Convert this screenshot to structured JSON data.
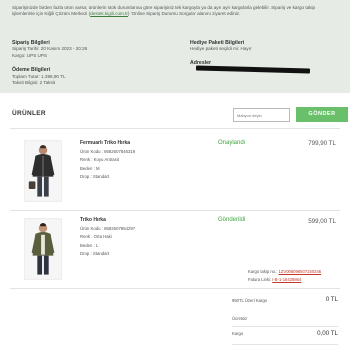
{
  "notice": {
    "text": "Siparişinizde birden fazla ürün varsa; ürünlerin stok durumlarına göre siparişiniz tek kargoyla ya da ayrı ayrı kargolarla gelebilir. Sipariş ve kargo takip işlemlerinle için Kiğili Çözüm Merkezi (",
    "link": "destek.kigili.com.tr",
    "text_after": ") 'Online Sipariş Durumu Sorgula' alanını ziyaret ediniz."
  },
  "order": {
    "heading": "Sipariş Bilgileri",
    "date": "Sipariş Tarihi: 20 Kasım 2023 - 20:26",
    "cargo": "Kargo: UPS UPS"
  },
  "payment": {
    "heading": "Ödeme Bilgileri",
    "total": "Toplam Tutar: 1.398,90 TL",
    "installment": "Taksit Bilgisi: 2 Taksit"
  },
  "gift": {
    "heading": "Hediye Paketi Bilgileri",
    "text": "Hediye paketi seçildi mi: Hayır"
  },
  "address": {
    "heading": "Adresler"
  },
  "products": {
    "title": "ÜRÜNLER",
    "search_placeholder": "Malıyon deyin",
    "send_label": "GÖNDER"
  },
  "items": [
    {
      "name": "Fermuarlı Triko Hırka",
      "code": "Ürün Kodu : 8682607846319",
      "color": "Renk : Koyu Antrasit",
      "size": "Beden : M",
      "stock": "Drop : Standart",
      "status": "Onaylandı",
      "price": "799,90 TL"
    },
    {
      "name": "Triko Hırka",
      "code": "Ürün Kodu : 8682607854297",
      "color": "Renk : Orta Haki",
      "size": "Beden : L",
      "stock": "Drop : Standart",
      "status": "Gönderildi",
      "price": "599,00 TL"
    }
  ],
  "tracking": {
    "label": "Kargo takip no.:",
    "number": "1ZV006096507150346",
    "invoice_label": "Fatura Linki:",
    "invoice": "I-B-1-16428864"
  },
  "summary": {
    "free_cargo_label": "950TL Üzeri Kargo",
    "free_cargo_value": "0 TL",
    "fee_label": "Ücretsiz",
    "cargo_label": "Kargo",
    "cargo_value": "0,00 TL"
  },
  "colors": {
    "accent": "#6abf6a",
    "status_green": "#3fa43f",
    "link_red": "#c0392b",
    "panel": "#e6ebe6"
  }
}
